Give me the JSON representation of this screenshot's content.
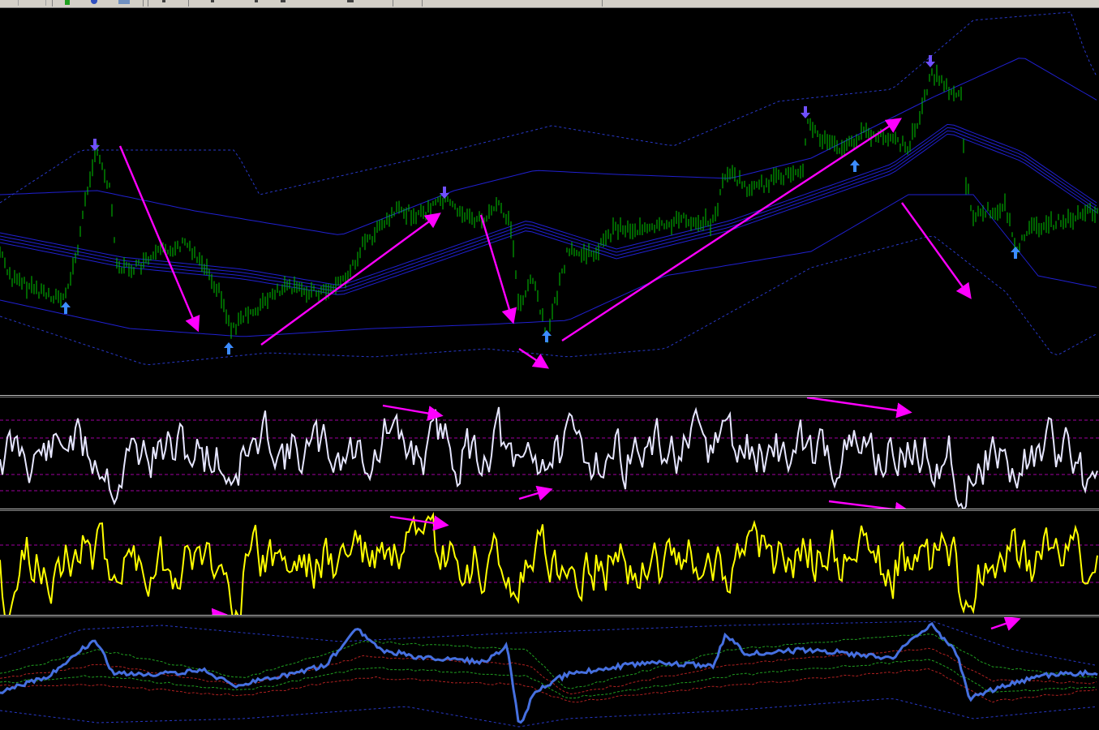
{
  "window": {
    "toolbar_icons": [
      "candle-icon",
      "period-icon",
      "clock-icon",
      "template-icon"
    ]
  },
  "colors": {
    "background": "#000000",
    "price_bars": "#00c800",
    "bands_solid": "#2020d0",
    "bands_dashed": "#2838c8",
    "trend_arrows": "#ff00ff",
    "signal_arrow_up": "#3c8cff",
    "signal_arrow_down": "#7050ff",
    "oscillator_1": "#e6e6ff",
    "oscillator_2": "#ffff00",
    "oscillator_3": "#4670e0",
    "level_lines": "#a000a0",
    "ma_green": "#20a020",
    "ma_red": "#b02020"
  },
  "panes": [
    {
      "name": "main-price-chart",
      "indicator": "price-with-bands"
    },
    {
      "name": "oscillator-white",
      "indicator": "oscillator"
    },
    {
      "name": "oscillator-yellow",
      "indicator": "oscillator"
    },
    {
      "name": "oscillator-blue",
      "indicator": "oscillator-with-bands"
    }
  ]
}
